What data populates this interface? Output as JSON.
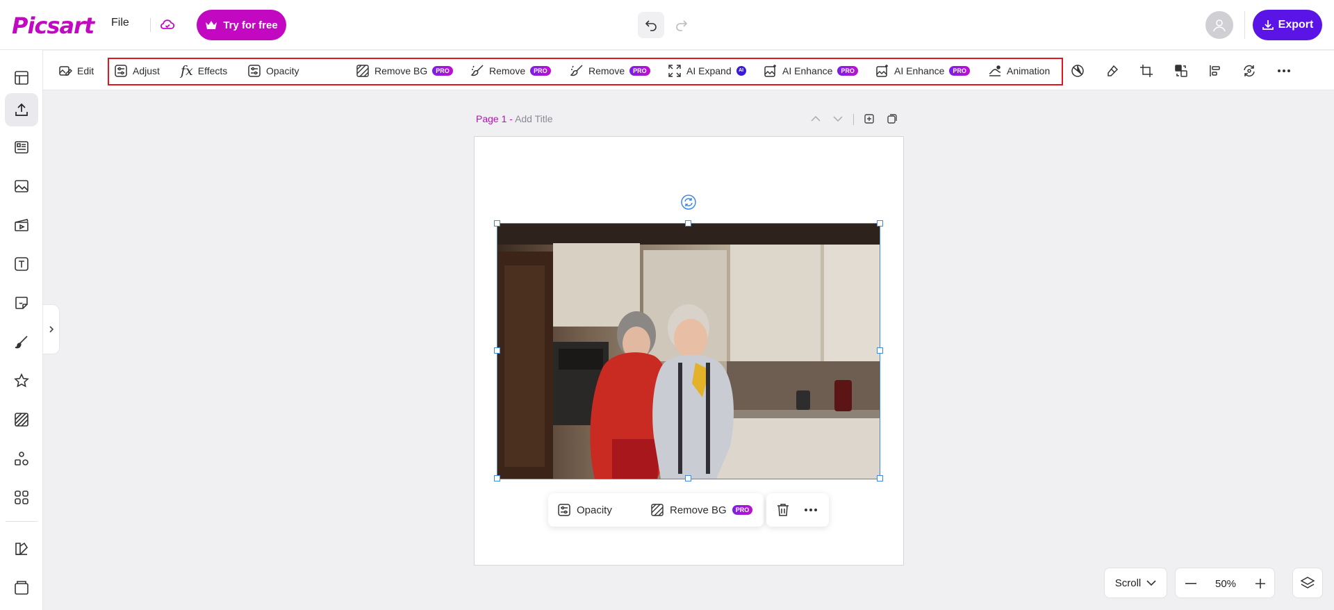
{
  "header": {
    "logo": "Picsart",
    "file_label": "File",
    "try_label": "Try for free",
    "export_label": "Export"
  },
  "toolbar": {
    "items": [
      {
        "label": "Edit",
        "icon": "edit-image-icon"
      },
      {
        "label": "Adjust",
        "icon": "adjust-icon"
      },
      {
        "label": "Effects",
        "icon": "fx-icon"
      },
      {
        "label": "Opacity",
        "icon": "opacity-icon"
      },
      {
        "label": "Remove BG",
        "icon": "remove-bg-icon",
        "badge": "PRO"
      },
      {
        "label": "Remove",
        "icon": "eraser-brush-icon",
        "badge": "PRO"
      },
      {
        "label": "Remove",
        "icon": "eraser-brush-icon",
        "badge": "PRO"
      },
      {
        "label": "AI Expand",
        "icon": "expand-icon",
        "badge": "AI"
      },
      {
        "label": "AI Enhance",
        "icon": "enhance-icon",
        "badge": "PRO"
      },
      {
        "label": "AI Enhance",
        "icon": "enhance-icon",
        "badge": "PRO"
      },
      {
        "label": "Animation",
        "icon": "animation-icon"
      }
    ],
    "icon_buttons": [
      "color-palette-icon",
      "eraser-icon",
      "crop-icon",
      "replace-icon",
      "align-icon",
      "flip-icon",
      "more-icon"
    ]
  },
  "canvas": {
    "page_number": "Page 1 -",
    "page_title_placeholder": "Add Title"
  },
  "floating_toolbar": {
    "opacity_label": "Opacity",
    "remove_bg_label": "Remove BG",
    "remove_bg_badge": "PRO"
  },
  "bottom": {
    "scroll_label": "Scroll",
    "zoom_value": "50%"
  },
  "colors": {
    "brand": "#c209c1",
    "export": "#5a14e6",
    "selection": "#3d8be0",
    "highlight": "#e3141b"
  }
}
